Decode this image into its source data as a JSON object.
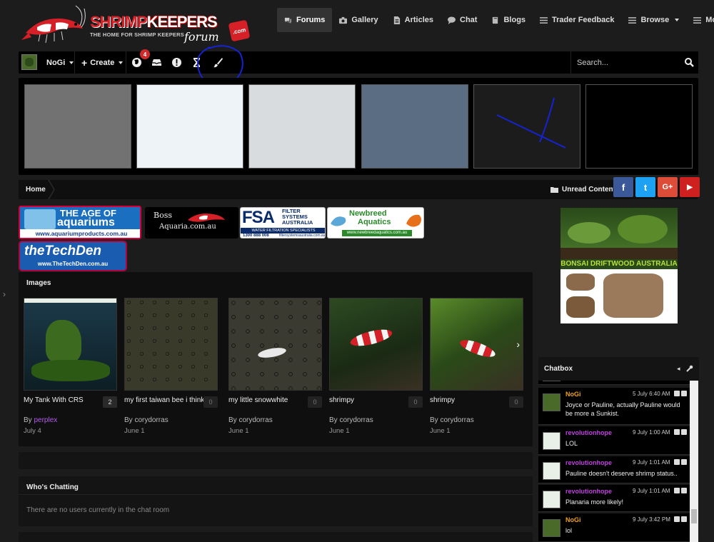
{
  "logo": {
    "title_part1": "SHRIMP",
    "title_part2": "KEEPERS",
    "subtitle": "THE HOME FOR SHRIMP KEEPERS",
    "script": "forum",
    "tld": ".com"
  },
  "nav": {
    "items": [
      {
        "label": "Forums",
        "icon": "comments-icon",
        "active": true
      },
      {
        "label": "Gallery",
        "icon": "camera-icon"
      },
      {
        "label": "Articles",
        "icon": "file-icon"
      },
      {
        "label": "Chat",
        "icon": "chat-icon"
      },
      {
        "label": "Blogs",
        "icon": "book-icon"
      },
      {
        "label": "Trader Feedback",
        "icon": "list-icon"
      },
      {
        "label": "Browse",
        "icon": "list-icon",
        "dropdown": true
      },
      {
        "label": "More",
        "icon": "menu-icon",
        "dropdown": true
      }
    ]
  },
  "userbar": {
    "username": "NoGi",
    "create_label": "Create",
    "notifications_count": "4"
  },
  "search": {
    "placeholder": "Search..."
  },
  "theme_swatches": [
    "#727272",
    "#eef3f8",
    "#d9dcdf",
    "#5b6d83",
    "#1c1c1c",
    "#000000"
  ],
  "breadcrumb": {
    "home": "Home",
    "unread": "Unread Content"
  },
  "social": [
    {
      "name": "facebook",
      "glyph": "f",
      "color": "#3b5998"
    },
    {
      "name": "twitter",
      "glyph": "t",
      "color": "#1da1f2"
    },
    {
      "name": "google-plus",
      "glyph": "G+",
      "color": "#dd4b39"
    },
    {
      "name": "youtube",
      "glyph": "▶",
      "color": "#cd201f"
    }
  ],
  "ads": {
    "age_of_aquariums": {
      "line1": "THE AGE OF",
      "line2": "aquariums",
      "url": "www.aquariumproducts.com.au"
    },
    "boss_aquaria": {
      "line1": "Boss",
      "line2": "Aquaria.com.au"
    },
    "fsa": {
      "abbr": "FSA",
      "name1": "FILTER",
      "name2": "SYSTEMS",
      "name3": "AUSTRALIA",
      "tag": "WATER FILTRATION SPECIALISTS",
      "phone": "1300 888 008",
      "web": "filtersystemsaustralia.com.au"
    },
    "newbreed": {
      "line1": "Newbreed",
      "line2": "Aquatics",
      "url": "www.newbreedaquatics.com.au"
    },
    "techden": {
      "name": "theTechDen",
      "url": "www.TheTechDen.com.au"
    },
    "bonsai": {
      "title": "BONSAI DRIFTWOOD AUSTRALIA"
    }
  },
  "images": {
    "title": "Images",
    "items": [
      {
        "title": "My Tank With CRS",
        "count": "2",
        "by": "By",
        "author": "perplex",
        "date": "July 4"
      },
      {
        "title": "my first taiwan bee i think",
        "count": "0",
        "by": "By",
        "author": "corydorras",
        "date": "June 1"
      },
      {
        "title": "my little snowwhite",
        "count": "0",
        "by": "By",
        "author": "corydorras",
        "date": "June 1"
      },
      {
        "title": "shrimpy",
        "count": "0",
        "by": "By",
        "author": "corydorras",
        "date": "June 1"
      },
      {
        "title": "shrimpy",
        "count": "0",
        "by": "By",
        "author": "corydorras",
        "date": "June 1"
      }
    ]
  },
  "whos_chatting": {
    "title": "Who's Chatting",
    "empty": "There are no users currently in the chat room"
  },
  "chatbox": {
    "title": "Chatbox",
    "messages": [
      {
        "name": "NoGi",
        "name_color": "#f0a020",
        "time": "5 July 6:40 AM",
        "text": "Joyce or Pauline, actually Pauline would be more a Sunkist."
      },
      {
        "name": "revolutionhope",
        "name_color": "#c040e0",
        "time": "9 July 1:00 AM",
        "text": "LOL"
      },
      {
        "name": "revolutionhope",
        "name_color": "#c040e0",
        "time": "9 July 1:01 AM",
        "text": "Pauline doesn't deserve shrimp status.."
      },
      {
        "name": "revolutionhope",
        "name_color": "#c040e0",
        "time": "9 July 1:01 AM",
        "text": "Planaria more likely!"
      },
      {
        "name": "NoGi",
        "name_color": "#f0a020",
        "time": "9 July 3:42 PM",
        "text": "lol"
      }
    ]
  }
}
